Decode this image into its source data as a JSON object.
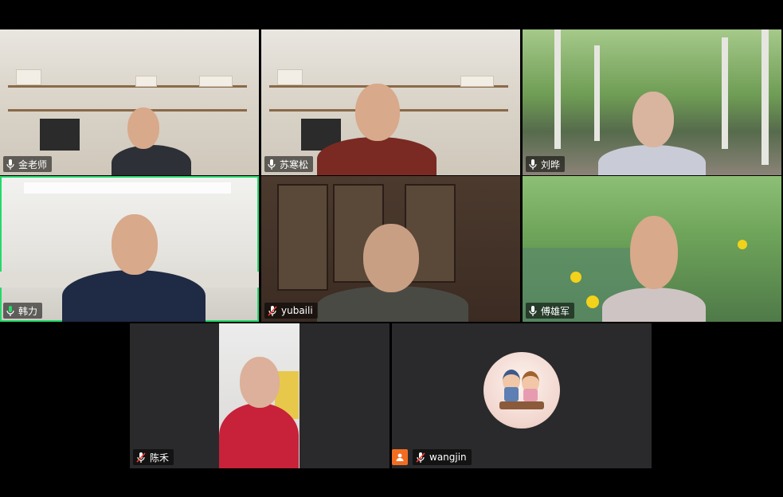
{
  "participants": [
    {
      "name": "金老师",
      "mic": "on",
      "active": false,
      "scene": "office"
    },
    {
      "name": "苏寒松",
      "mic": "on",
      "active": false,
      "scene": "office"
    },
    {
      "name": "刘晔",
      "mic": "on",
      "active": false,
      "scene": "trees"
    },
    {
      "name": "韩力",
      "mic": "on",
      "active": true,
      "scene": "meeting-room"
    },
    {
      "name": "yubaili",
      "mic": "muted",
      "active": false,
      "scene": "study"
    },
    {
      "name": "傅雄军",
      "mic": "on",
      "active": false,
      "scene": "pond"
    },
    {
      "name": "陈禾",
      "mic": "muted",
      "active": false,
      "scene": "indoor"
    },
    {
      "name": "wangjin",
      "mic": "muted",
      "active": false,
      "scene": "avatar-only"
    }
  ],
  "colors": {
    "active_border": "#23d96b",
    "muted_slash": "#ff3b30",
    "avatar_badge": "#f26d21",
    "tile_bg": "#2a2a2c"
  },
  "icons": {
    "mic_on": "microphone-icon",
    "mic_muted": "microphone-muted-icon",
    "profile": "profile-avatar-icon"
  }
}
